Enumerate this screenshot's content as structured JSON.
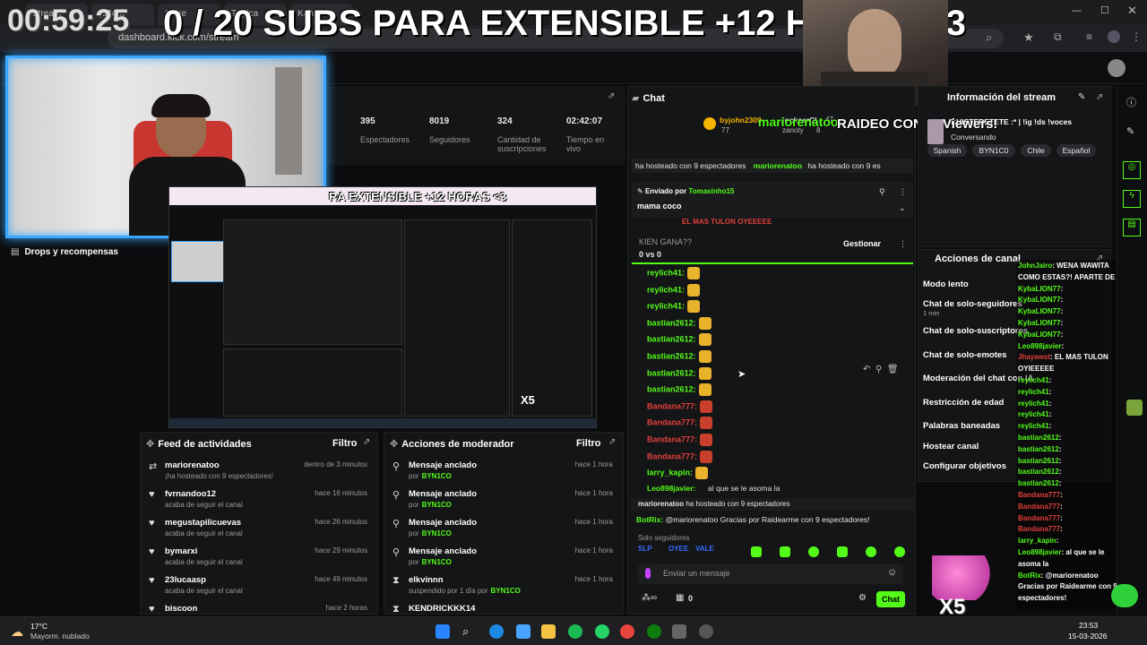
{
  "browser": {
    "tabs": [
      "Stream",
      "(5348)",
      "Goxe",
      "Tópica",
      "Kanlo"
    ],
    "url": "dashboard.kick.com/stream"
  },
  "overlay": {
    "timer": "00:59:25",
    "goal_text": "0 / 20 SUBS PARA EXTENSIBLE +12 HORAS <3"
  },
  "stats": [
    {
      "value": "395",
      "label": "Espectadores"
    },
    {
      "value": "8019",
      "label": "Seguidores"
    },
    {
      "value": "324",
      "label": "Cantidad de suscripciones"
    },
    {
      "value": "02:42:07",
      "label": "Tiempo en vivo"
    }
  ],
  "drops_label": "Drops y recompensas",
  "nested_preview_text": "RA EXTENSIBLE +12 HORAS <3",
  "chat": {
    "title": "Chat",
    "leaderboard": {
      "user1": "byjohn2309",
      "user1_count": "77",
      "user2": "JockeerCL",
      "user2_count": "47",
      "user3": "zanoty",
      "user3_count": "8"
    },
    "raid_overlay_user": "mariorenatoo",
    "raid_overlay_text": "RAIDEO CON 9 viewers!",
    "host_banner_left": "ha hosteado con 9 espectadores",
    "host_banner_user": "mariorenatoo",
    "host_banner_right": "ha hosteado con 9 es",
    "pinned_sender_label": "Enviado por",
    "pinned_sender": "Tomasinho15",
    "pinned_message": "mama coco",
    "pinned_under": "EL MAS TULON OYEEEEE",
    "poll_title": "KIEN GANA??",
    "poll_score": "0 vs 0",
    "manage_label": "Gestionar",
    "messages": [
      {
        "user": "reylich41:",
        "color": "green"
      },
      {
        "user": "reylich41:",
        "color": "green"
      },
      {
        "user": "reylich41:",
        "color": "green"
      },
      {
        "user": "bastian2612:",
        "color": "green"
      },
      {
        "user": "bastian2612:",
        "color": "green"
      },
      {
        "user": "bastian2612:",
        "color": "green"
      },
      {
        "user": "bastian2612:",
        "color": "green"
      },
      {
        "user": "bastian2612:",
        "color": "green"
      },
      {
        "user": "Bandana777:",
        "color": "red"
      },
      {
        "user": "Bandana777:",
        "color": "red"
      },
      {
        "user": "Bandana777:",
        "color": "red"
      },
      {
        "user": "Bandana777:",
        "color": "red"
      },
      {
        "user": "larry_kapin:",
        "color": "green"
      }
    ],
    "last_message_user": "Leo898javier:",
    "last_message_text": "al que se le asoma la",
    "host_notice_user": "mariorenatoo",
    "host_notice_text": "ha hosteado con 9 espectadores",
    "bot_user": "BotRix:",
    "bot_text": "@mariorenatoo Gracias por Raidearme con 9 espectadores!",
    "followers_only": "Solo seguidores",
    "input_placeholder": "Enviar un mensaje",
    "footer_count": "0",
    "send_label": "Chat"
  },
  "stream_info": {
    "title": "Información del stream",
    "stream_title": "CHISTERETETE :* | !ig !ds !voces",
    "category": "Conversando",
    "tags": [
      "Spanish",
      "BYN1C0",
      "Chile",
      "Español"
    ],
    "viewers_overlay": "Viewers!"
  },
  "channel_actions": {
    "title": "Acciones de canal",
    "items": [
      {
        "label": "Modo lento",
        "sub": ""
      },
      {
        "label": "Chat de solo-seguidores",
        "sub": "1 min"
      },
      {
        "label": "Chat de solo-suscriptores",
        "sub": ""
      },
      {
        "label": "Chat de solo-emotes",
        "sub": ""
      },
      {
        "label": "Moderación del chat con IA",
        "sub": ""
      },
      {
        "label": "Restricción de edad",
        "sub": ""
      },
      {
        "label": "Palabras baneadas",
        "sub": ""
      },
      {
        "label": "Hostear canal",
        "sub": ""
      },
      {
        "label": "Configurar objetivos",
        "sub": ""
      }
    ]
  },
  "side_chat": [
    {
      "user": "JohnJairo",
      "text": ": WENA WAWITA",
      "color": "#53fc18"
    },
    {
      "user": "",
      "text": "COMO ESTAS?! APARTE DE PEGAO",
      "color": "#ffffff"
    },
    {
      "user": "KybaLION77",
      "text": ":",
      "color": "#53fc18"
    },
    {
      "user": "KybaLION77",
      "text": ":",
      "color": "#53fc18"
    },
    {
      "user": "KybaLION77",
      "text": ":",
      "color": "#53fc18"
    },
    {
      "user": "KybaLION77",
      "text": ":",
      "color": "#53fc18"
    },
    {
      "user": "KybaLION77",
      "text": ":",
      "color": "#53fc18"
    },
    {
      "user": "Leo898javier",
      "text": ":",
      "color": "#53fc18"
    },
    {
      "user": "Jhaywest",
      "text": ": EL MAS TULON",
      "color": "#e0403a"
    },
    {
      "user": "",
      "text": "OYIEEEEE",
      "color": "#ffffff"
    },
    {
      "user": "reylich41",
      "text": ":",
      "color": "#53fc18"
    },
    {
      "user": "reylich41",
      "text": ":",
      "color": "#53fc18"
    },
    {
      "user": "reylich41",
      "text": ":",
      "color": "#53fc18"
    },
    {
      "user": "reylich41",
      "text": ":",
      "color": "#53fc18"
    },
    {
      "user": "reylich41",
      "text": ":",
      "color": "#53fc18"
    },
    {
      "user": "bastian2612",
      "text": ":",
      "color": "#53fc18"
    },
    {
      "user": "bastian2612",
      "text": ":",
      "color": "#53fc18"
    },
    {
      "user": "bastian2612",
      "text": ":",
      "color": "#53fc18"
    },
    {
      "user": "bastian2612",
      "text": ":",
      "color": "#53fc18"
    },
    {
      "user": "bastian2612",
      "text": ":",
      "color": "#53fc18"
    },
    {
      "user": "Bandana777",
      "text": ":",
      "color": "#e0403a"
    },
    {
      "user": "Bandana777",
      "text": ":",
      "color": "#e0403a"
    },
    {
      "user": "Bandana777",
      "text": ":",
      "color": "#e0403a"
    },
    {
      "user": "Bandana777",
      "text": ":",
      "color": "#e0403a"
    },
    {
      "user": "larry_kapin",
      "text": ":",
      "color": "#53fc18"
    },
    {
      "user": "Leo898javier",
      "text": ": al que se le",
      "color": "#53fc18"
    },
    {
      "user": "",
      "text": "asoma la",
      "color": "#ffffff"
    },
    {
      "user": "BotRix",
      "text": ": @mariorenatoo",
      "color": "#53fc18"
    },
    {
      "user": "",
      "text": "Gracias por Raidearme con 9",
      "color": "#ffffff"
    },
    {
      "user": "",
      "text": "espectadores!",
      "color": "#ffffff"
    }
  ],
  "activity_feed": {
    "title": "Feed de actividades",
    "filter": "Filtro",
    "items": [
      {
        "name": "mariorenatoo",
        "sub": "¡ha hosteado con 9 espectadores!",
        "time": "dentro de 3 minutos",
        "icon": "host-icon"
      },
      {
        "name": "fvrnandoo12",
        "sub": "acaba de seguir el canal",
        "time": "hace 16 minutos",
        "icon": "heart-icon"
      },
      {
        "name": "megustapilicuevas",
        "sub": "acaba de seguir el canal",
        "time": "hace 26 minutos",
        "icon": "heart-icon"
      },
      {
        "name": "bymarxi",
        "sub": "acaba de seguir el canal",
        "time": "hace 29 minutos",
        "icon": "heart-icon"
      },
      {
        "name": "23lucaasp",
        "sub": "acaba de seguir el canal",
        "time": "hace 49 minutos",
        "icon": "heart-icon"
      },
      {
        "name": "biscoon",
        "sub": "",
        "time": "hace 2 horas",
        "icon": "heart-icon"
      }
    ]
  },
  "mod_actions": {
    "title": "Acciones de moderador",
    "filter": "Filtro",
    "items": [
      {
        "name": "Mensaje anclado",
        "sub_prefix": "por",
        "sub_user": "BYN1CO",
        "time": "hace 1 hora",
        "icon": "pin-icon"
      },
      {
        "name": "Mensaje anclado",
        "sub_prefix": "por",
        "sub_user": "BYN1CO",
        "time": "hace 1 hora",
        "icon": "pin-icon"
      },
      {
        "name": "Mensaje anclado",
        "sub_prefix": "por",
        "sub_user": "BYN1CO",
        "time": "hace 1 hora",
        "icon": "pin-icon"
      },
      {
        "name": "Mensaje anclado",
        "sub_prefix": "por",
        "sub_user": "BYN1CO",
        "time": "hace 1 hora",
        "icon": "pin-icon"
      },
      {
        "name": "elkvinnn",
        "sub_prefix": "suspendido por 1 día por",
        "sub_user": "BYN1CO",
        "time": "hace 1 hora",
        "icon": "hourglass-icon"
      },
      {
        "name": "KENDRICKKK14",
        "sub_prefix": "",
        "sub_user": "",
        "time": "",
        "icon": "hourglass-icon"
      }
    ]
  },
  "taskbar": {
    "weather_temp": "17°C",
    "weather_desc": "Mayorm. nublado",
    "time": "23:53",
    "date": "15-03-2026"
  },
  "x5_label": "X5"
}
